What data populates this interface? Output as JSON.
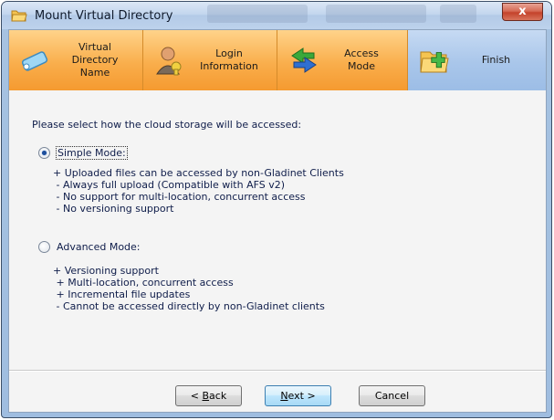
{
  "window": {
    "title": "Mount Virtual Directory",
    "close_label": "x"
  },
  "steps": [
    {
      "label": "Virtual\nDirectory\nName",
      "icon": "virtual-directory-icon",
      "active": false
    },
    {
      "label": "Login\nInformation",
      "icon": "login-user-icon",
      "active": false
    },
    {
      "label": "Access\nMode",
      "icon": "access-arrows-icon",
      "active": false
    },
    {
      "label": "Finish",
      "icon": "finish-folder-icon",
      "active": true
    }
  ],
  "content": {
    "prompt": "Please select how the cloud storage will be accessed:",
    "simple": {
      "label": "Simple Mode:",
      "selected": true,
      "lines": [
        "+ Uploaded files can be accessed by non-Gladinet Clients",
        " - Always full upload (Compatible with AFS v2)",
        " - No support for multi-location, concurrent access",
        " - No versioning support"
      ]
    },
    "advanced": {
      "label": "Advanced Mode:",
      "selected": false,
      "lines": [
        "+ Versioning support",
        " + Multi-location, concurrent access",
        " + Incremental file updates",
        " - Cannot be accessed directly by non-Gladinet clients"
      ]
    }
  },
  "buttons": {
    "back": {
      "pre": "< ",
      "mnemonic": "B",
      "post": "ack"
    },
    "next": {
      "pre": "",
      "mnemonic": "N",
      "post": "ext >"
    },
    "cancel": "Cancel"
  },
  "colors": {
    "step_orange": "#f9ae4c",
    "step_active_blue": "#a9c6ea",
    "text_navy": "#0f1d4a"
  }
}
